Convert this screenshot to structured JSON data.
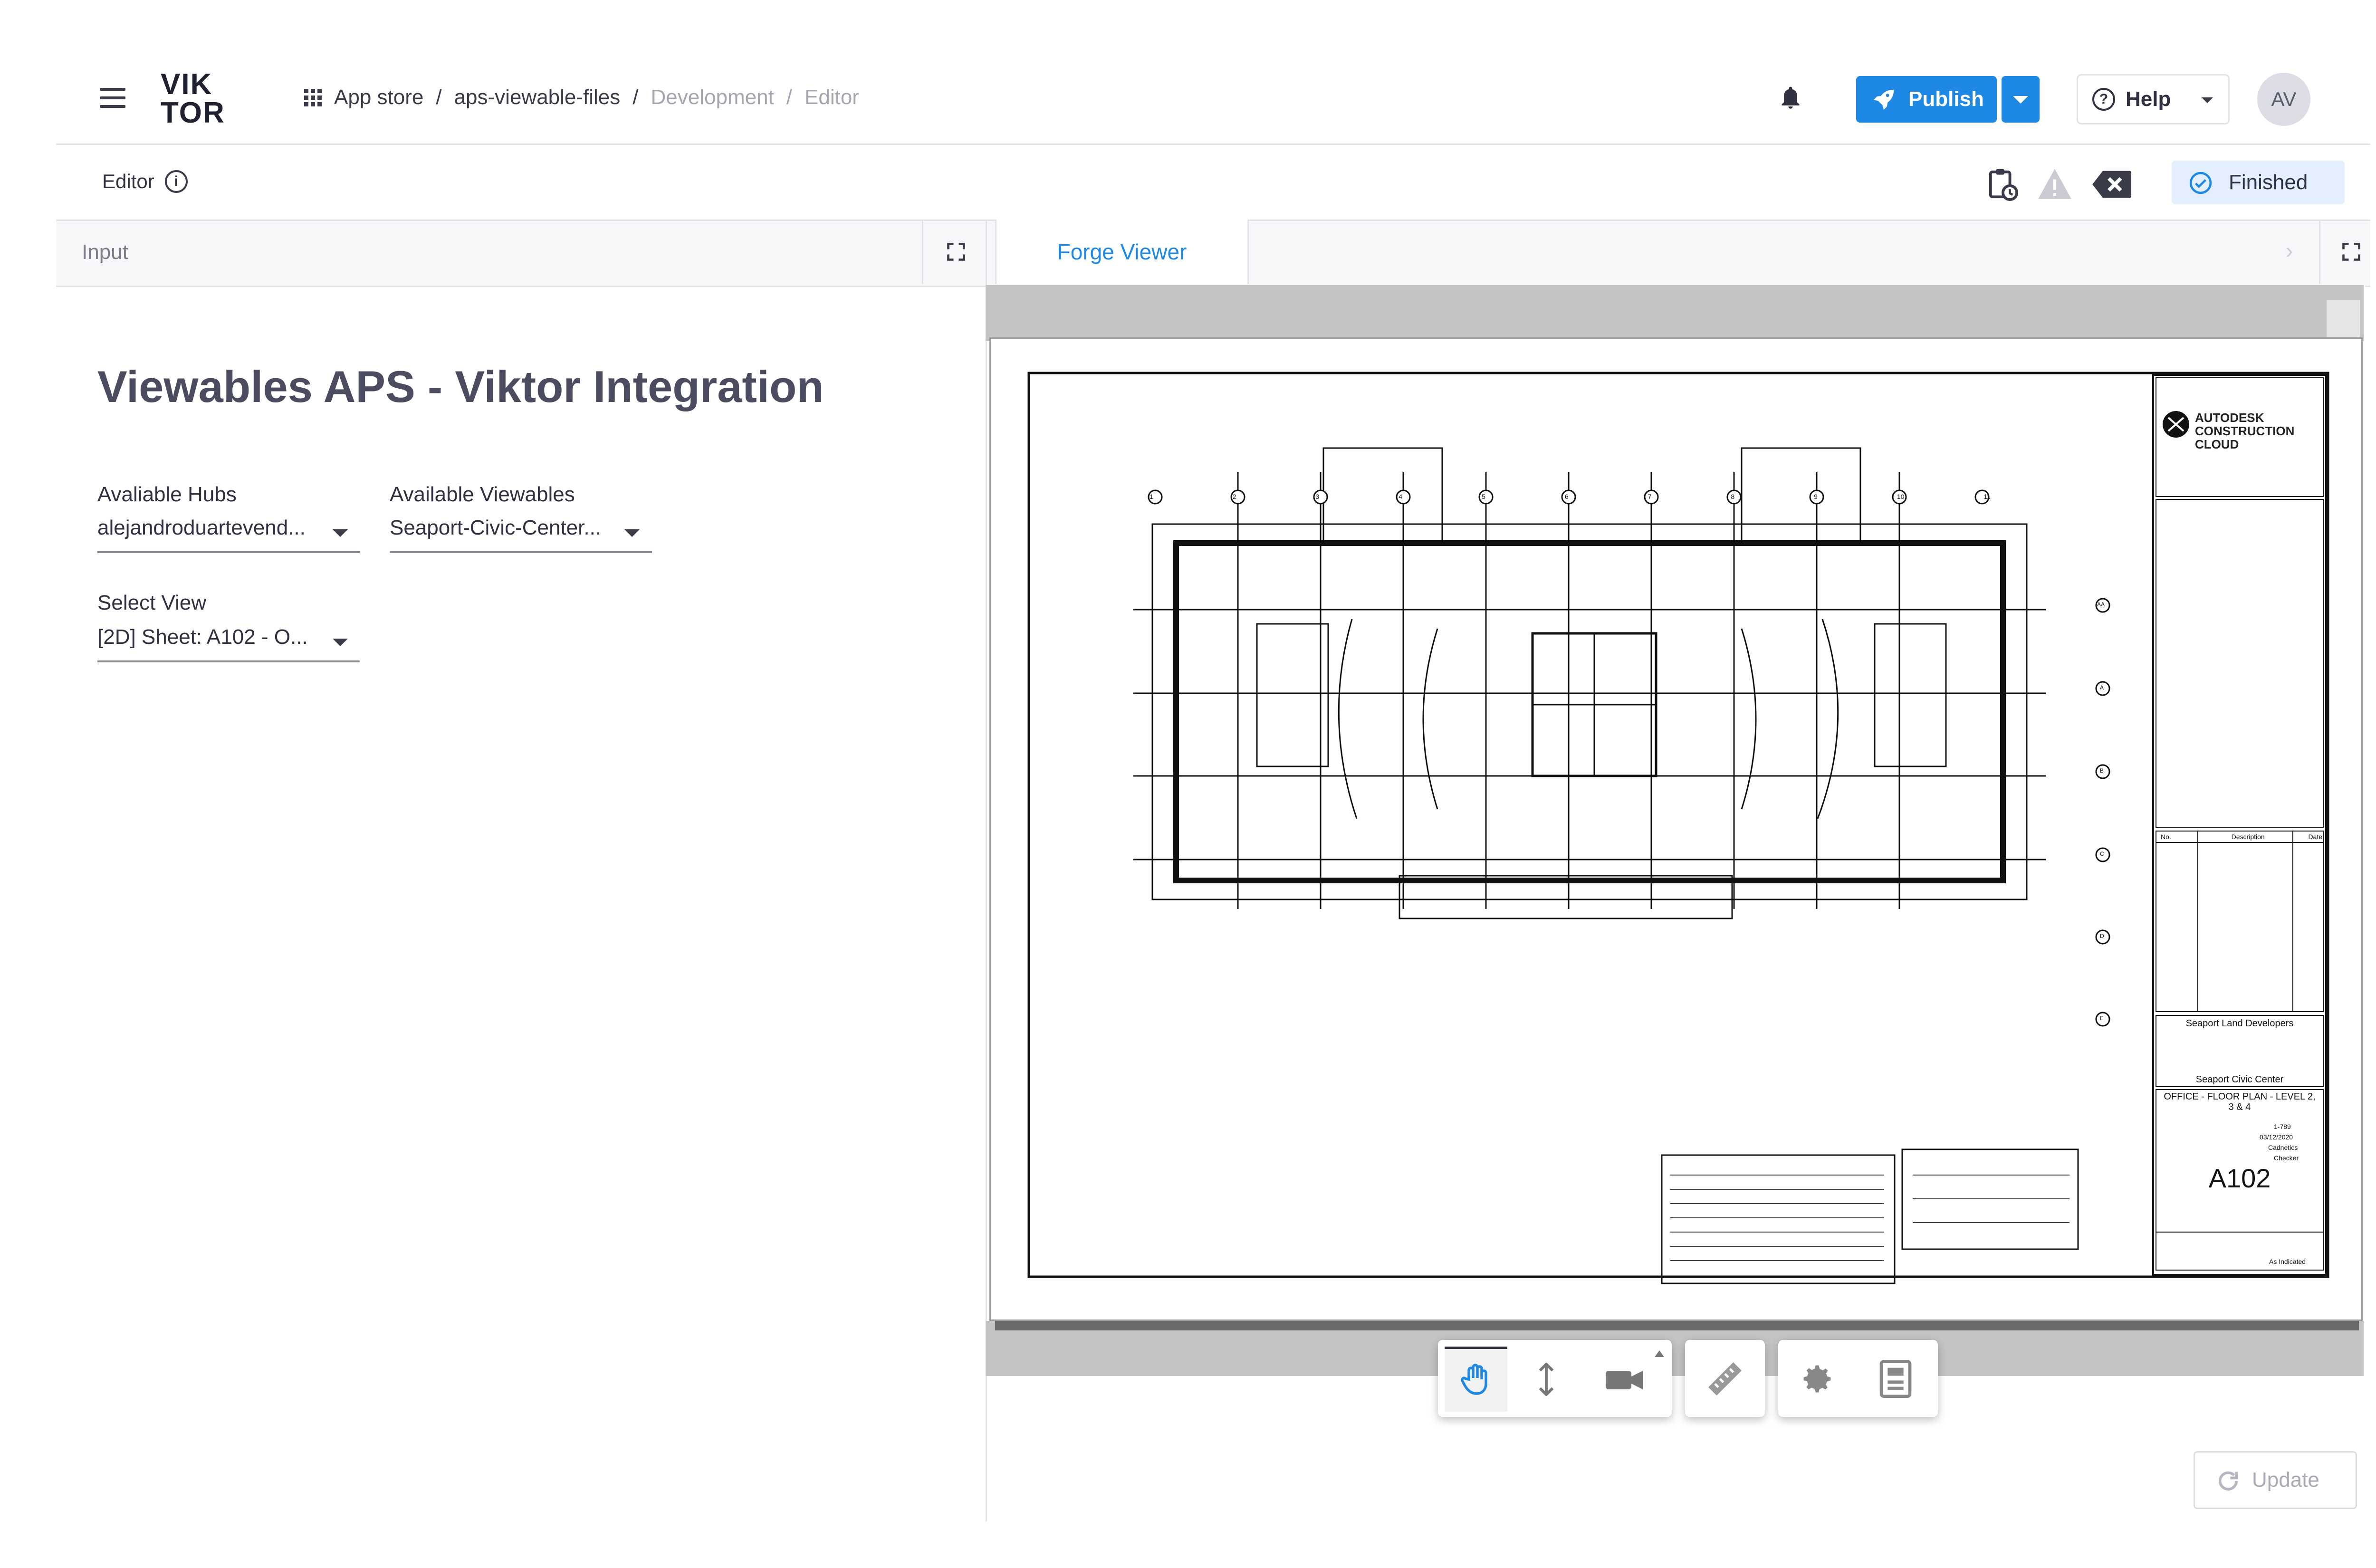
{
  "header": {
    "logo_line1": "VIK",
    "logo_line2": "TOR",
    "breadcrumbs": [
      "App store",
      "aps-viewable-files",
      "Development",
      "Editor"
    ],
    "publish_label": "Publish",
    "help_label": "Help",
    "avatar_initials": "AV"
  },
  "subheader": {
    "editor_label": "Editor",
    "status_label": "Finished"
  },
  "panels": {
    "input_tab": "Input",
    "viewer_tab": "Forge Viewer"
  },
  "form": {
    "title": "Viewables APS - Viktor Integration",
    "hubs": {
      "label": "Avaliable Hubs",
      "value": "alejandroduartevend..."
    },
    "viewables": {
      "label": "Available Viewables",
      "value": "Seaport-Civic-Center..."
    },
    "view": {
      "label": "Select View",
      "value": "[2D] Sheet: A102 - O..."
    }
  },
  "drawing": {
    "brand_line1": "AUTODESK",
    "brand_line2": "CONSTRUCTION",
    "brand_line3": "CLOUD",
    "grid_numbers": [
      "1",
      "2",
      "3",
      "4",
      "5",
      "6",
      "7",
      "8",
      "9",
      "10",
      "11"
    ],
    "grid_letters": [
      "AA",
      "A",
      "B",
      "C",
      "D",
      "E"
    ],
    "rev_headers": [
      "No.",
      "Description",
      "Date"
    ],
    "client": "Seaport Land Developers",
    "project": "Seaport Civic Center",
    "sheet_title": "OFFICE - FLOOR PLAN - LEVEL 2, 3 & 4",
    "sheet_number": "A102",
    "scale": "As Indicated",
    "date": "03/12/2020",
    "project_number": "1-789",
    "drawn_by": "Cadnetics",
    "checked_by": "Checker"
  },
  "viewer_toolbar": {
    "tools": [
      "pan-icon",
      "zoom-icon",
      "camera-icon",
      "measure-icon",
      "settings-icon",
      "properties-icon"
    ]
  },
  "actions": {
    "update_label": "Update"
  },
  "colors": {
    "accent": "#1e88e5",
    "status_bg": "#e3efff",
    "title": "#4b4c60"
  }
}
